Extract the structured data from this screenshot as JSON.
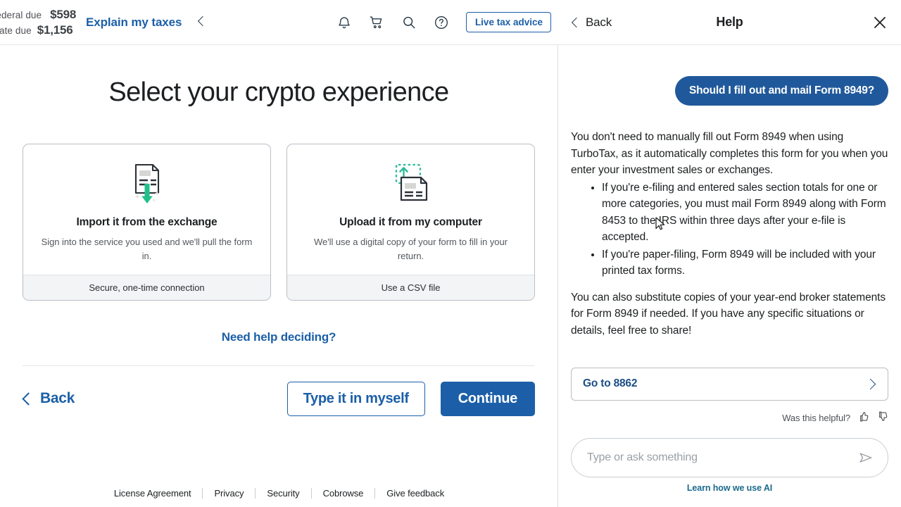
{
  "topbar": {
    "refund": [
      {
        "label": "Federal due",
        "amount": "$598"
      },
      {
        "label": "State due",
        "amount": "$1,156"
      }
    ],
    "explain_link": "Explain my taxes",
    "collapse_icon": "chevron-left-icon",
    "icons": [
      "bell-icon",
      "cart-icon",
      "search-icon",
      "help-circle-icon"
    ],
    "live_tax_advice": "Live tax advice"
  },
  "main": {
    "title": "Select your crypto experience",
    "cards": [
      {
        "icon": "document-download-icon",
        "title": "Import it from the exchange",
        "subtitle": "Sign into the service you used and we'll pull the form in.",
        "footer": "Secure, one-time connection"
      },
      {
        "icon": "document-upload-icon",
        "title": "Upload it from my computer",
        "subtitle": "We'll use a digital copy of your form to fill in your return.",
        "footer": "Use a CSV file"
      }
    ],
    "need_help": "Need help deciding?",
    "back": "Back",
    "type_it_in": "Type it in myself",
    "continue": "Continue"
  },
  "footer": {
    "links": [
      "License Agreement",
      "Privacy",
      "Security",
      "Cobrowse",
      "Give feedback"
    ]
  },
  "help": {
    "back": "Back",
    "title": "Help",
    "close_icon": "close-icon",
    "user_message": "Should I fill out and mail Form 8949?",
    "answer_p1": "You don't need to manually fill out Form 8949 when using TurboTax, as it automatically completes this form for you when you enter your investment sales or exchanges.",
    "answer_bullets": [
      "If you're e-filing and entered sales section totals for one or more categories, you must mail Form 8949 along with Form 8453 to the IRS within three days after your e-file is accepted.",
      "If you're paper-filing, Form 8949 will be included with your printed tax forms."
    ],
    "answer_p2": "You can also substitute copies of your year-end broker statements for Form 8949 if needed. If you have any specific situations or details, feel free to share!",
    "goto_label": "Go to 8862",
    "helpful_text": "Was this helpful?",
    "thumbs_up_icon": "thumbs-up-icon",
    "thumbs_down_icon": "thumbs-down-icon",
    "input_placeholder": "Type or ask something",
    "send_icon": "send-icon",
    "learn_ai": "Learn how we use AI"
  },
  "colors": {
    "brand_blue": "#1c5fa8",
    "bubble_blue": "#20599b",
    "accent_green": "#21c08b",
    "accent_teal": "#2bb999",
    "text_dark": "#1c1f21",
    "link_teal": "#1d6a8e"
  }
}
